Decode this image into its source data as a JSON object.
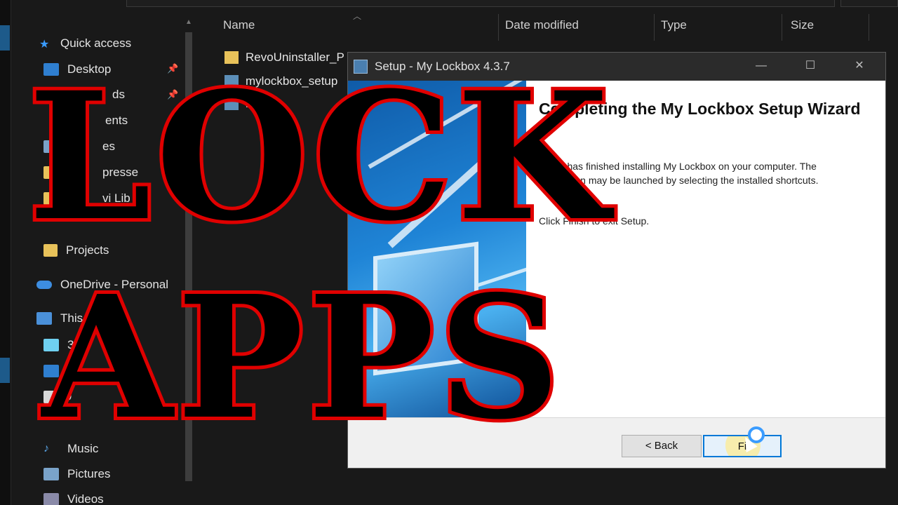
{
  "explorer": {
    "columns": {
      "name": "Name",
      "date_modified": "Date modified",
      "type": "Type",
      "size": "Size"
    },
    "files": [
      {
        "name": "RevoUninstaller_P",
        "kind": "folder"
      },
      {
        "name": "mylockbox_setup",
        "kind": "exe"
      },
      {
        "name": "lockb",
        "kind": "exe"
      }
    ],
    "nav": {
      "quick_access": "Quick access",
      "desktop": "Desktop",
      "downloads_partial": "ds",
      "documents_partial": "ents",
      "pictures_partial": "es",
      "compressed_partial": "presse",
      "library_partial": "vi Lib",
      "projects": "Projects",
      "onedrive": "OneDrive - Personal",
      "this_pc": "This PC",
      "objects3d_partial": "3D",
      "desktop2_partial": "D",
      "documents2_partial": "D",
      "music": "Music",
      "pictures": "Pictures",
      "videos": "Videos"
    }
  },
  "dialog": {
    "title": "Setup - My Lockbox 4.3.7",
    "window_controls": {
      "minimize": "—",
      "maximize": "☐",
      "close": "✕"
    },
    "heading": "Completing the My Lockbox Setup Wizard",
    "body": "Setup has finished installing My Lockbox on your computer. The application may be launched by selecting the installed shortcuts.",
    "body2": "Click Finish to exit Setup.",
    "back_button": "< Back",
    "finish_button": "Fi"
  },
  "overlay": {
    "line1": "LOCK",
    "line2": "APPS",
    "text_color": "#000000",
    "outline_color": "#e00000"
  },
  "icons": {
    "quick_access": "star-icon",
    "folder": "folder-icon",
    "installer": "installer-icon",
    "pin": "pin-icon",
    "onedrive": "cloud-icon",
    "this_pc": "computer-icon"
  }
}
